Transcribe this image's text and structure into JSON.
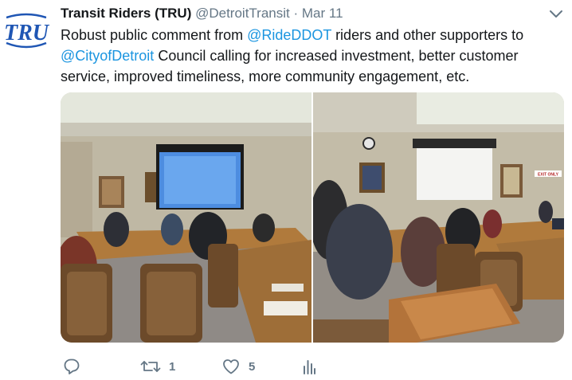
{
  "tweet": {
    "author_name": "Transit Riders (TRU)",
    "handle": "@DetroitTransit",
    "separator": "·",
    "date": "Mar 11",
    "text_part1": "Robust public comment from ",
    "mention1": "@RideDDOT",
    "text_part2": " riders and other supporters to ",
    "mention2": "@CityofDetroit",
    "text_part3": " Council calling for increased investment, better customer service, improved timeliness, more community engagement, etc."
  },
  "avatar": {
    "logo_text": "TRU",
    "icon": "tru-logo"
  },
  "media": {
    "photos": [
      {
        "icon": "council-meeting-photo"
      },
      {
        "icon": "council-meeting-photo"
      }
    ],
    "signs": {
      "exit_only": "EXIT ONLY"
    }
  },
  "actions": {
    "reply": {
      "icon": "reply-icon",
      "count": ""
    },
    "retweet": {
      "icon": "retweet-icon",
      "count": "1"
    },
    "like": {
      "icon": "heart-icon",
      "count": "5"
    },
    "analytics": {
      "icon": "analytics-icon",
      "count": ""
    }
  },
  "colors": {
    "link": "#1b95e0",
    "muted": "#657786",
    "text": "#14171a",
    "logo_blue": "#1f56b4"
  }
}
